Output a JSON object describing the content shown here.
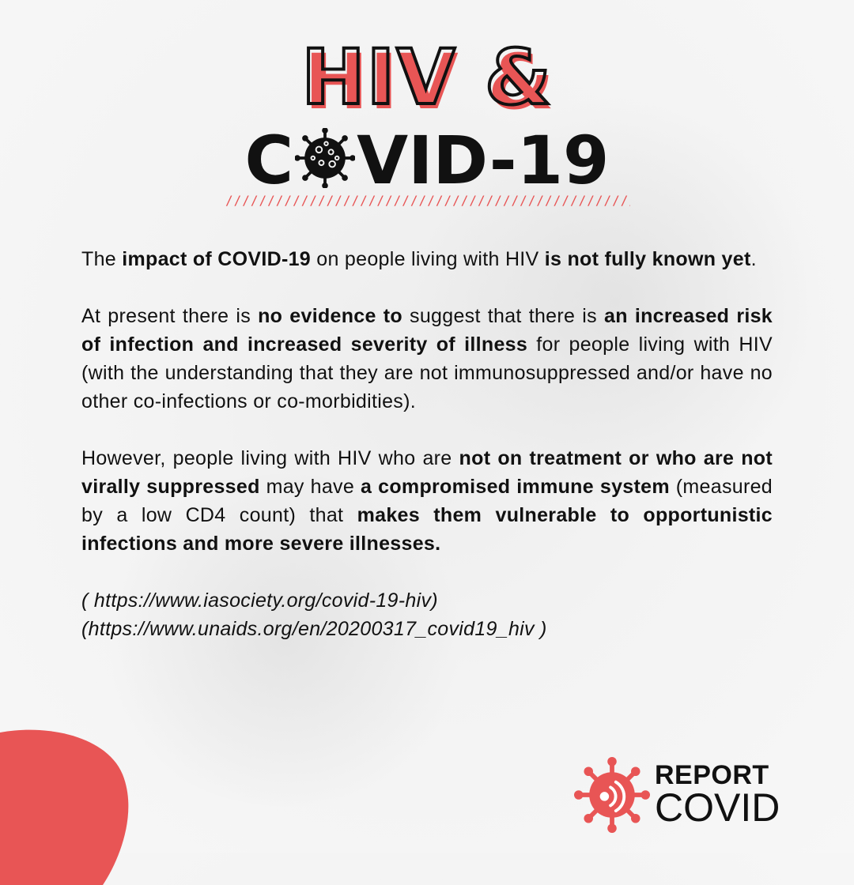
{
  "title": {
    "line1": "HIV &",
    "line2_prefix": "C",
    "line2_suffix": "VID-19"
  },
  "paragraphs": [
    [
      {
        "t": "The ",
        "b": false
      },
      {
        "t": "impact of COVID-19",
        "b": true
      },
      {
        "t": " on people living with HIV ",
        "b": false
      },
      {
        "t": "is not fully known yet",
        "b": true
      },
      {
        "t": ".",
        "b": false
      }
    ],
    [
      {
        "t": "At present there is ",
        "b": false
      },
      {
        "t": "no evidence to",
        "b": true
      },
      {
        "t": " suggest that there is ",
        "b": false
      },
      {
        "t": "an increased risk of infection and increased severity of illness",
        "b": true
      },
      {
        "t": " for people living with HIV (with the understanding that they are not immunosuppressed and/or have no other co-infections or co-morbidities).",
        "b": false
      }
    ],
    [
      {
        "t": "However, people living with HIV who are ",
        "b": false
      },
      {
        "t": "not on treatment or who are not virally suppressed",
        "b": true
      },
      {
        "t": " may have ",
        "b": false
      },
      {
        "t": "a compromised immune system",
        "b": true
      },
      {
        "t": " (measured by a low CD4 count) that ",
        "b": false
      },
      {
        "t": "makes them vulnerable to opportunistic infections and more severe illnesses.",
        "b": true
      }
    ]
  ],
  "references": [
    "( https://www.iasociety.org/covid-19-hiv)",
    "(https://www.unaids.org/en/20200317_covid19_hiv )"
  ],
  "logo": {
    "line1": "REPORT",
    "line2": "COVID"
  },
  "colors": {
    "accent": "#e85555",
    "text": "#111111",
    "background": "#f4f4f4"
  },
  "icons": {
    "title_o": "virus-icon",
    "logo": "virus-icon"
  }
}
